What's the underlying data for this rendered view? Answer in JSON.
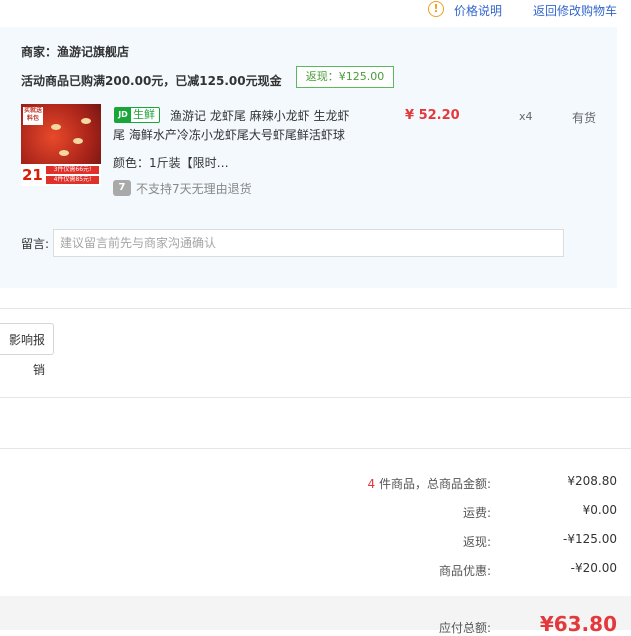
{
  "header": {
    "price_info_link": "价格说明",
    "back_to_cart_link": "返回修改购物车"
  },
  "order": {
    "merchant": "商家：渔游记旗舰店",
    "promo_text": "活动商品已购满200.00元，已减125.00元现金",
    "rebate_badge": "返现：¥125.00",
    "product": {
      "image_tag": "买就送料包",
      "image_price": "21",
      "image_offer_1": "3件仅需66元!",
      "image_offer_2": "4件仅需85元!",
      "fresh_icon": "JD",
      "fresh_label": "生鲜",
      "title_line1": "渔游记 龙虾尾 麻辣小龙虾 生龙虾",
      "title_line2": "尾 海鲜水产冷冻小龙虾尾大号虾尾鲜活虾球",
      "price": "¥ 52.20",
      "quantity": "x4",
      "stock": "有货",
      "color_spec": "颜色：1斤装【限时…",
      "return_icon_text": "7",
      "return_policy": "不支持7天无理由退货"
    },
    "note_label": "留言:",
    "note_placeholder": "建议留言前先与商家沟通确认"
  },
  "invoice_button": "影响报销",
  "summary": {
    "count": "4",
    "count_suffix": " 件商品，总商品金额:",
    "total_goods_amount": "¥208.80",
    "shipping_label": "运费:",
    "shipping": "¥0.00",
    "rebate_label": "返现:",
    "rebate": "-¥125.00",
    "discount_label": "商品优惠:",
    "discount": "-¥20.00",
    "payable_label": "应付总额:",
    "payable": "¥63.80"
  },
  "colors": {
    "accent_red": "#e4393c",
    "link_blue": "#3366cc",
    "fresh_green": "#1aa539",
    "panel_bg": "#f3f9fd"
  }
}
